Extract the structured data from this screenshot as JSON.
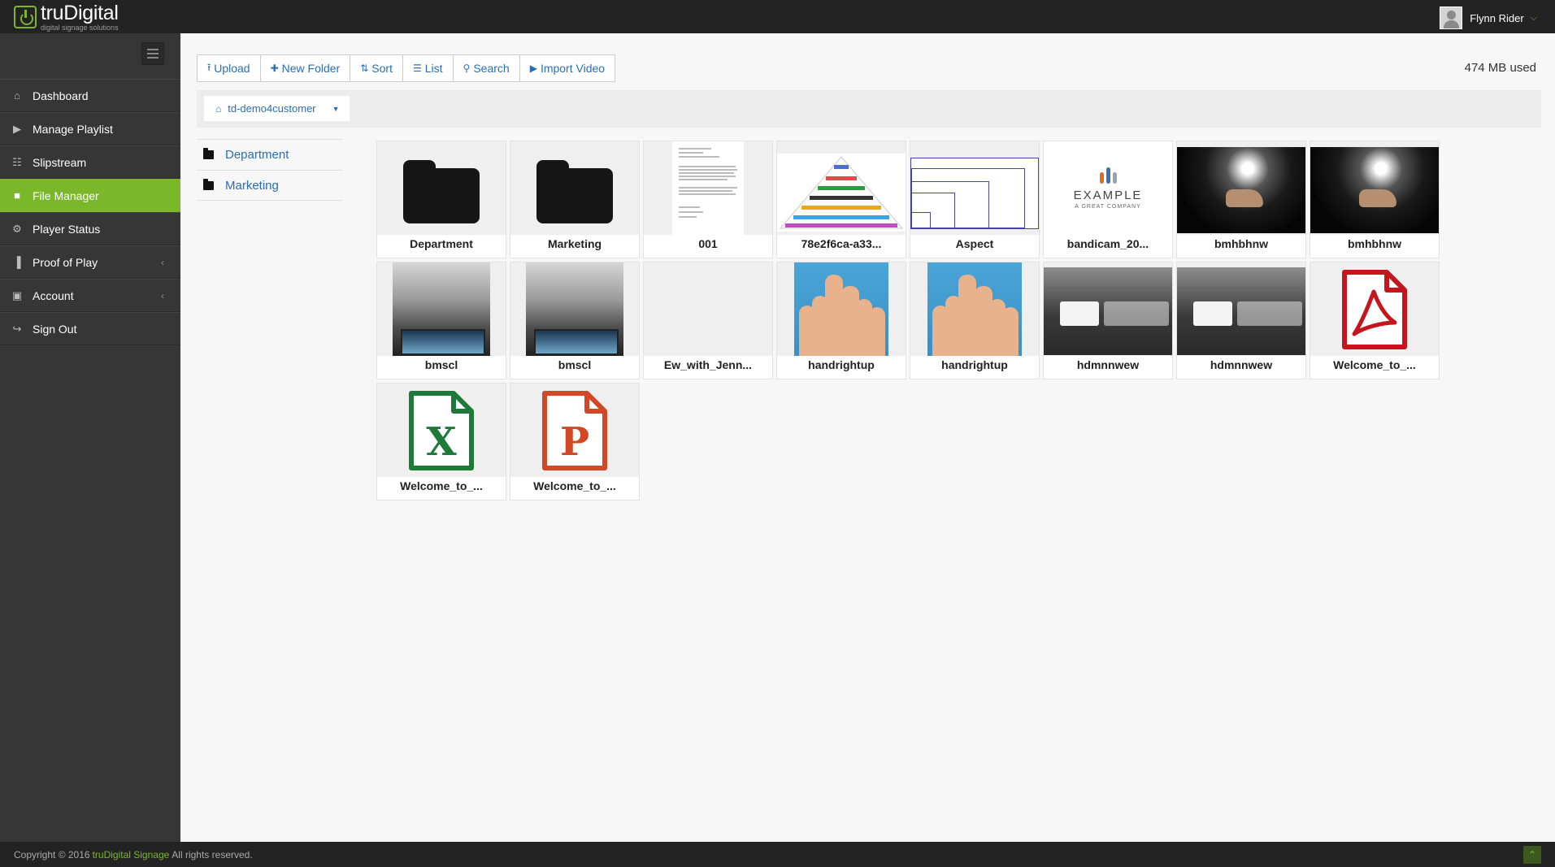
{
  "app": {
    "name": "truDigital",
    "tagline": "digital signage solutions"
  },
  "user": {
    "name": "Flynn Rider"
  },
  "sidebar": {
    "items": [
      {
        "label": "Dashboard",
        "icon": "home-icon",
        "active": false
      },
      {
        "label": "Manage Playlist",
        "icon": "play-icon",
        "active": false
      },
      {
        "label": "Slipstream",
        "icon": "sitemap-icon",
        "active": false
      },
      {
        "label": "File Manager",
        "icon": "folder-icon",
        "active": true
      },
      {
        "label": "Player Status",
        "icon": "cogs-icon",
        "active": false
      },
      {
        "label": "Proof of Play",
        "icon": "bar-chart-icon",
        "active": false,
        "expandable": true
      },
      {
        "label": "Account",
        "icon": "briefcase-icon",
        "active": false,
        "expandable": true
      },
      {
        "label": "Sign Out",
        "icon": "sign-out-icon",
        "active": false
      }
    ]
  },
  "toolbar": {
    "upload": "Upload",
    "new_folder": "New Folder",
    "sort": "Sort",
    "list": "List",
    "search": "Search",
    "import_video": "Import Video"
  },
  "storage": {
    "used": "474 MB used"
  },
  "breadcrumb": {
    "current": "td-demo4customer"
  },
  "folder_tree": [
    {
      "label": "Department"
    },
    {
      "label": "Marketing"
    }
  ],
  "files": [
    {
      "name": "Department",
      "type": "folder"
    },
    {
      "name": "Marketing",
      "type": "folder"
    },
    {
      "name": "001",
      "type": "document"
    },
    {
      "name": "78e2f6ca-a33...",
      "type": "image"
    },
    {
      "name": "Aspect",
      "type": "image"
    },
    {
      "name": "bandicam_20...",
      "type": "image"
    },
    {
      "name": "bmhbhnw",
      "type": "image"
    },
    {
      "name": "bmhbhnw",
      "type": "image"
    },
    {
      "name": "bmscl",
      "type": "image"
    },
    {
      "name": "bmscl",
      "type": "image"
    },
    {
      "name": "Ew_with_Jenn...",
      "type": "video"
    },
    {
      "name": "handrightup",
      "type": "image"
    },
    {
      "name": "handrightup",
      "type": "image"
    },
    {
      "name": "hdmnnwew",
      "type": "image"
    },
    {
      "name": "hdmnnwew",
      "type": "image"
    },
    {
      "name": "Welcome_to_...",
      "type": "pdf"
    },
    {
      "name": "Welcome_to_...",
      "type": "excel"
    },
    {
      "name": "Welcome_to_...",
      "type": "powerpoint"
    }
  ],
  "thumbnail_text": {
    "example_word": "EXAMPLE",
    "example_sub": "A GREAT COMPANY"
  },
  "footer": {
    "prefix": "Copyright © 2016",
    "brand": "truDigital Signage",
    "suffix": "All rights reserved."
  },
  "colors": {
    "accent": "#7bb72a",
    "link": "#2a6db5",
    "topbar": "#232323",
    "sidebar": "#363636",
    "pdf": "#c4161c",
    "excel": "#1f7a3a",
    "powerpoint": "#d24726"
  }
}
